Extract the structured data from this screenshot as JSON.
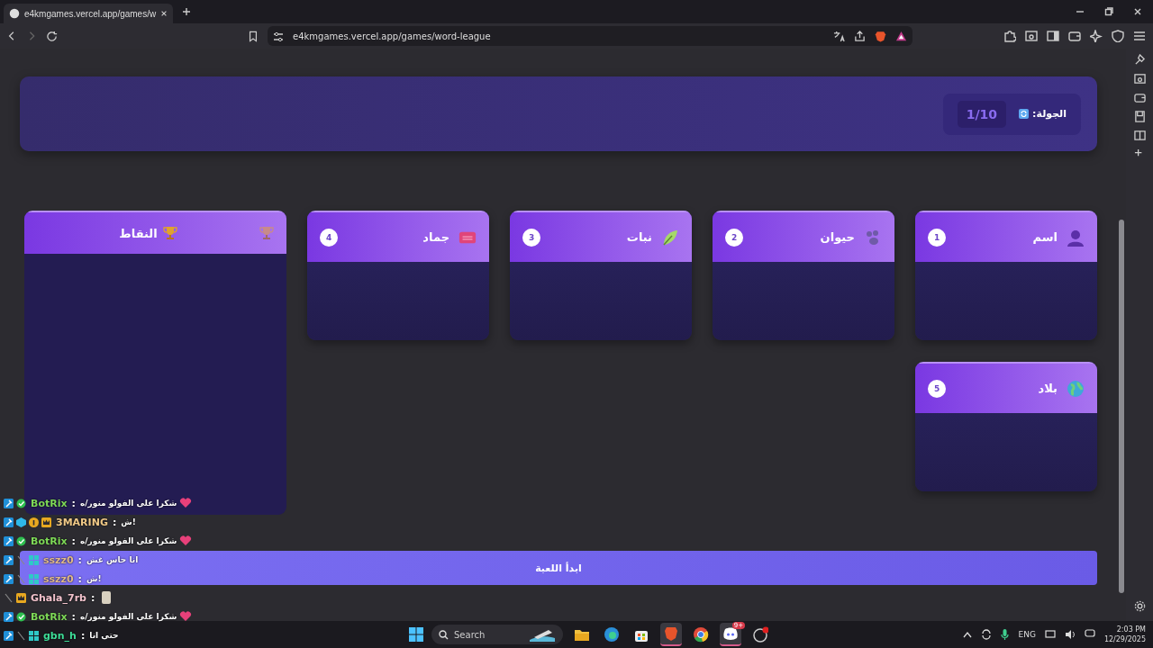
{
  "browser": {
    "tab_title": "e4kmgames.vercel.app/games/w",
    "url": "e4kmgames.vercel.app/games/word-league"
  },
  "game": {
    "round_label": "الجولة:",
    "round_value": "1/10",
    "points_title": "النقاط",
    "categories": [
      {
        "name": "اسم",
        "number": "1",
        "kind": "person"
      },
      {
        "name": "حيوان",
        "number": "2",
        "kind": "paw"
      },
      {
        "name": "نبات",
        "number": "3",
        "kind": "leaf"
      },
      {
        "name": "جماد",
        "number": "4",
        "kind": "box"
      },
      {
        "name": "بلاد",
        "number": "5",
        "kind": "globe"
      }
    ],
    "start_button": "ابدأ اللعبة"
  },
  "chat": [
    {
      "badges": [
        {
          "kind": "mod"
        },
        {
          "kind": "verified"
        }
      ],
      "name": "BotRix",
      "color": "#7ed957",
      "separator": ":",
      "message": "شكرا على الفولو منور/ه",
      "emote": {
        "kind": "heart"
      }
    },
    {
      "badges": [
        {
          "kind": "mod"
        },
        {
          "kind": "gem"
        },
        {
          "kind": "tier"
        },
        {
          "kind": "crown"
        }
      ],
      "name": "3MARING",
      "color": "#f0c987",
      "separator": ":",
      "message": "ش!"
    },
    {
      "badges": [
        {
          "kind": "mod"
        },
        {
          "kind": "verified"
        }
      ],
      "name": "BotRix",
      "color": "#7ed957",
      "separator": ":",
      "message": "شكرا على الفولو منور/ه",
      "emote": {
        "kind": "heart"
      }
    },
    {
      "badges": [
        {
          "kind": "mod"
        },
        {
          "kind": "slash"
        },
        {
          "kind": "sub"
        }
      ],
      "name": "sszz0",
      "color": "#e0b98a",
      "separator": ":",
      "message": "انا حاس غش"
    },
    {
      "badges": [
        {
          "kind": "mod"
        },
        {
          "kind": "slash"
        },
        {
          "kind": "sub"
        }
      ],
      "name": "sszz0",
      "color": "#e0b98a",
      "separator": ":",
      "message": "ش!"
    },
    {
      "badges": [
        {
          "kind": "slash"
        },
        {
          "kind": "crown"
        }
      ],
      "name": "Ghala_7rb",
      "color": "#f2c2cc",
      "separator": ":",
      "emote": {
        "kind": "picture"
      }
    },
    {
      "badges": [
        {
          "kind": "mod"
        },
        {
          "kind": "verified"
        }
      ],
      "name": "BotRix",
      "color": "#7ed957",
      "separator": ":",
      "message": "شكرا على الفولو منور/ه",
      "emote": {
        "kind": "heart"
      }
    },
    {
      "badges": [
        {
          "kind": "mod"
        },
        {
          "kind": "slash"
        },
        {
          "kind": "sub"
        }
      ],
      "name": "gbn_h",
      "color": "#3ddc97",
      "separator": ":",
      "message": "حتى انا"
    }
  ],
  "taskbar": {
    "search_placeholder": "Search",
    "apps": [
      {
        "kind": "folder",
        "active": false
      },
      {
        "kind": "edge",
        "active": false
      },
      {
        "kind": "store",
        "active": false
      },
      {
        "kind": "brave",
        "active": true
      },
      {
        "kind": "chrome",
        "active": false
      },
      {
        "kind": "discord",
        "active": true,
        "badge": "9+"
      },
      {
        "kind": "obs",
        "active": false
      }
    ],
    "language": "ENG",
    "time": "2:03 PM",
    "date": "12/29/2025"
  }
}
